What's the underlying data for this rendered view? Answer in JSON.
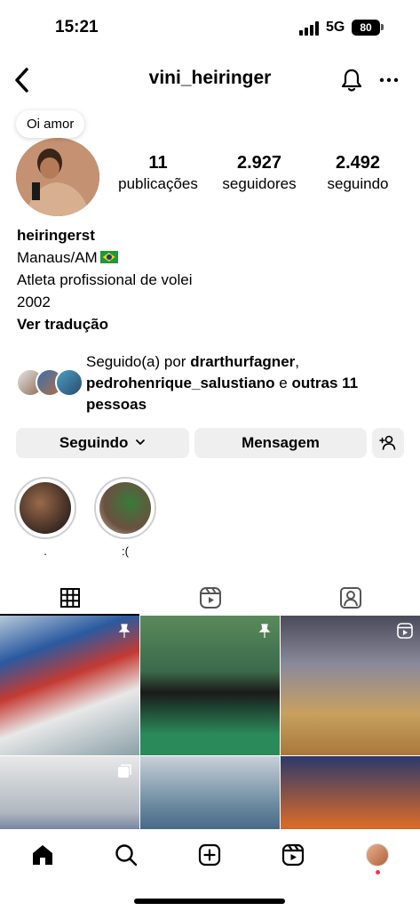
{
  "status_bar": {
    "time": "15:21",
    "network": "5G",
    "battery": "80"
  },
  "header": {
    "username": "vini_heiringer",
    "icons": [
      "chevron-left-icon",
      "bell-icon",
      "more-horizontal-icon"
    ]
  },
  "profile": {
    "note": "Oi amor",
    "stats": [
      {
        "value": "11",
        "label": "publicações"
      },
      {
        "value": "2.927",
        "label": "seguidores"
      },
      {
        "value": "2.492",
        "label": "seguindo"
      }
    ],
    "bio": {
      "name": "heiringerst",
      "location": "Manaus/AM",
      "flag": "brazil-flag-icon",
      "description": "Atleta profissional de volei",
      "year": "2002",
      "translate_label": "Ver tradução"
    },
    "followed_by": {
      "prefix": "Seguido(a) por ",
      "first": "drarthurfagner",
      "comma": ",",
      "second": "pedrohenrique_salustiano",
      "conjunction": " e ",
      "rest": "outras 11 pessoas"
    }
  },
  "actions": {
    "following_label": "Seguindo",
    "message_label": "Mensagem"
  },
  "highlights": [
    {
      "label": "."
    },
    {
      "label": ":("
    }
  ],
  "tabs": [
    "grid-icon",
    "reels-icon",
    "tagged-icon"
  ],
  "bottom_nav": [
    "home-icon",
    "search-icon",
    "create-icon",
    "reels-icon",
    "profile-avatar"
  ],
  "colors": {
    "button_bg": "#efefef",
    "text": "#000000",
    "notification_dot": "#ff2d55"
  }
}
